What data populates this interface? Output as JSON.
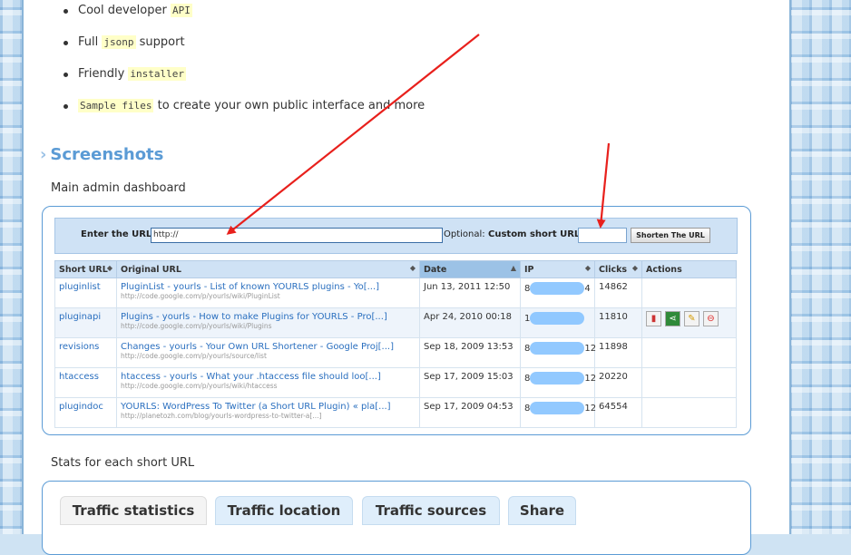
{
  "features": [
    {
      "before": "Cool developer ",
      "code": "API",
      "after": ""
    },
    {
      "before": "Full ",
      "code": "jsonp",
      "after": " support"
    },
    {
      "before": "Friendly ",
      "code": "installer",
      "after": ""
    },
    {
      "before": "",
      "code": "Sample files",
      "after": " to create your own public interface and more"
    }
  ],
  "section": {
    "chevron": "›",
    "title": "Screenshots"
  },
  "caption_dashboard": "Main admin dashboard",
  "caption_stats": "Stats for each short URL",
  "urlbar": {
    "enter_label": "Enter the URL:",
    "url_value": "http://",
    "optional": "Optional:",
    "custom_label": "Custom short URL:",
    "shorten_button": "Shorten The URL"
  },
  "table": {
    "headers": [
      "Short URL",
      "Original URL",
      "Date",
      "IP",
      "Clicks",
      "Actions"
    ],
    "rows": [
      {
        "short": "pluginlist",
        "title": "PluginList - yourls - List of known YOURLS plugins - Yo[...]",
        "url": "http://code.google.com/p/yourls/wiki/PluginList",
        "date": "Jun 13, 2011 12:50",
        "ip_start": "8",
        "ip_end": "4",
        "clicks": "14862"
      },
      {
        "short": "pluginapi",
        "title": "Plugins - yourls - How to make Plugins for YOURLS - Pro[...]",
        "url": "http://code.google.com/p/yourls/wiki/Plugins",
        "date": "Apr 24, 2010 00:18",
        "ip_start": "1",
        "ip_end": "",
        "clicks": "11810"
      },
      {
        "short": "revisions",
        "title": "Changes - yourls - Your Own URL Shortener - Google Proj[...]",
        "url": "http://code.google.com/p/yourls/source/list",
        "date": "Sep 18, 2009 13:53",
        "ip_start": "8",
        "ip_end": "12",
        "clicks": "11898"
      },
      {
        "short": "htaccess",
        "title": "htaccess - yourls - What your .htaccess file should loo[...]",
        "url": "http://code.google.com/p/yourls/wiki/htaccess",
        "date": "Sep 17, 2009 15:03",
        "ip_start": "8",
        "ip_end": "12",
        "clicks": "20220"
      },
      {
        "short": "plugindoc",
        "title": "YOURLS: WordPress To Twitter (a Short URL Plugin) « pla[...]",
        "url": "http://planetozh.com/blog/yourls-wordpress-to-twitter-a[...]",
        "date": "Sep 17, 2009 04:53",
        "ip_start": "8",
        "ip_end": "12",
        "clicks": "64554"
      }
    ]
  },
  "tabs": [
    "Traffic statistics",
    "Traffic location",
    "Traffic sources",
    "Share"
  ],
  "colors": {
    "accent": "#5b9bd5",
    "arrow": "#e8201c",
    "code_bg": "#ffffc8"
  }
}
